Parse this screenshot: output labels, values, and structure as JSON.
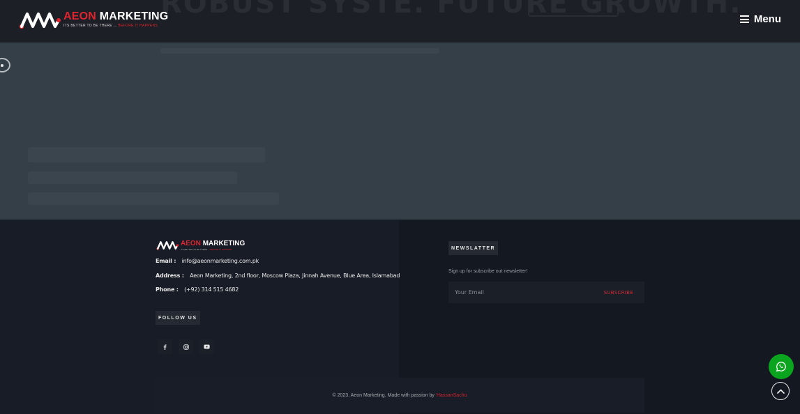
{
  "brand": {
    "name_part1": "AEON",
    "name_part2": "MARKETING",
    "tagline_main": "ITS BETTER TO BE THERE ...",
    "tagline_accent": "BEFORE IT HAPPENS"
  },
  "header": {
    "menu_label": "Menu",
    "menu_icon": "hamburger-icon"
  },
  "colors": {
    "brand_red": "#e0242f",
    "whatsapp_green": "#0ba41e",
    "footer_bg": "#141821",
    "overlay_bg": "#343f48"
  },
  "footer": {
    "contact": {
      "email_label": "Email :",
      "email_value": "info@aeonmarketing.com.pk",
      "address_label": "Address :",
      "address_value": "Aeon Marketing, 2nd floor, Moscow Plaza, Jinnah Avenue, Blue Area, Islamabad",
      "phone_label": "Phone :",
      "phone_value": "(+92) 314 515 4682"
    },
    "follow_title": "FOLLOW US",
    "socials": [
      {
        "name": "facebook-icon"
      },
      {
        "name": "instagram-icon"
      },
      {
        "name": "youtube-icon"
      }
    ],
    "newsletter": {
      "title": "NEWSLATTER",
      "subtitle": "Sign up for subscribe out newsletter!",
      "placeholder": "Your Email",
      "button_label": "SUBSCRIBE"
    },
    "copyright": {
      "text": "© 2023, Aeon Marketing. Made with passion by",
      "link_text": "HassanSachu"
    }
  },
  "floating": {
    "whatsapp_icon": "whatsapp-icon",
    "scroll_top_icon": "chevron-up-icon"
  }
}
